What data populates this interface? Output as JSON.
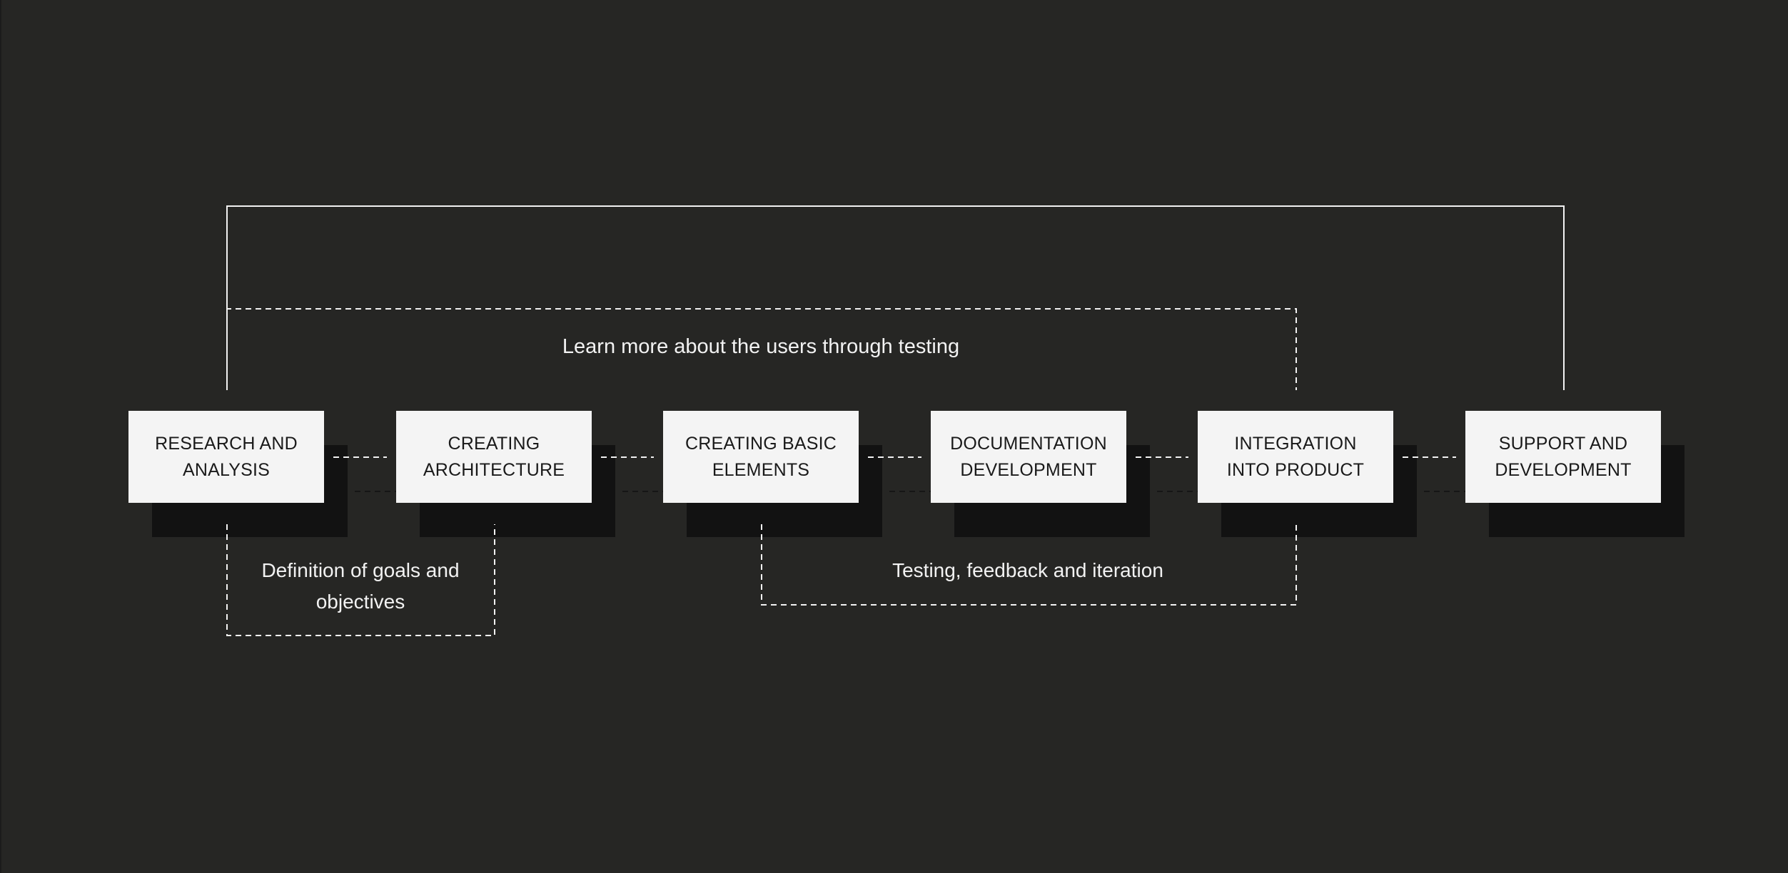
{
  "diagram": {
    "type": "process-flow",
    "background_color": "#262624",
    "box_color": "#f4f4f4",
    "shadow_color": "#121212",
    "line_color": "#f2f2f2",
    "steps": [
      {
        "id": "research",
        "label": "RESEARCH AND\nANALYSIS"
      },
      {
        "id": "architecture",
        "label": "CREATING\nARCHITECTURE"
      },
      {
        "id": "basic-elements",
        "label": "CREATING BASIC\nELEMENTS"
      },
      {
        "id": "documentation",
        "label": "DOCUMENTATION\nDEVELOPMENT"
      },
      {
        "id": "integration",
        "label": "INTEGRATION\nINTO PRODUCT"
      },
      {
        "id": "support",
        "label": "SUPPORT AND\nDEVELOPMENT"
      }
    ],
    "sequential_connectors": [
      {
        "from": "research",
        "to": "architecture",
        "style": "dashed"
      },
      {
        "from": "architecture",
        "to": "basic-elements",
        "style": "dashed"
      },
      {
        "from": "basic-elements",
        "to": "documentation",
        "style": "dashed"
      },
      {
        "from": "documentation",
        "to": "integration",
        "style": "dashed"
      },
      {
        "from": "integration",
        "to": "support",
        "style": "dashed"
      }
    ],
    "loops": [
      {
        "id": "outer-loop",
        "from": "support",
        "to": "research",
        "side": "top",
        "style": "solid",
        "label": ""
      },
      {
        "id": "user-testing-loop",
        "from": "integration",
        "to": "research",
        "side": "top",
        "style": "dashed",
        "label": "Learn more about the users through testing"
      },
      {
        "id": "goals-loop",
        "from": "research",
        "to": "architecture",
        "side": "bottom",
        "style": "dashed",
        "label": "Definition of goals and\nobjectives"
      },
      {
        "id": "testing-loop",
        "from": "basic-elements",
        "to": "integration",
        "side": "bottom",
        "style": "dashed",
        "label": "Testing, feedback and iteration"
      }
    ]
  }
}
